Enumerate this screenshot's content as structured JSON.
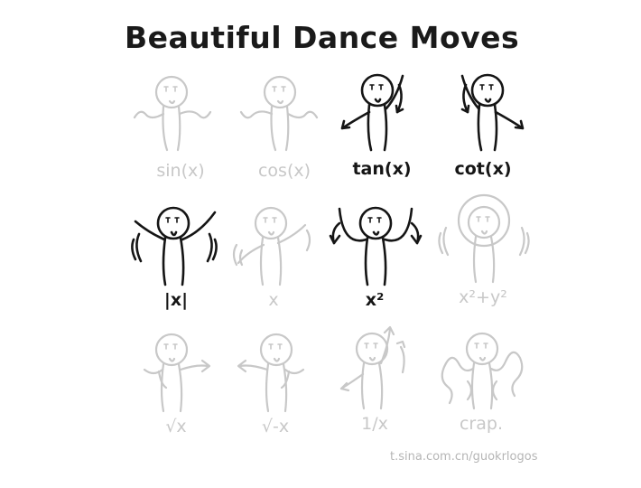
{
  "title": "Beautiful Dance Moves",
  "moves": [
    {
      "label": "sin(x)",
      "highlighted": false
    },
    {
      "label": "cos(x)",
      "highlighted": false
    },
    {
      "label": "tan(x)",
      "highlighted": true
    },
    {
      "label": "cot(x)",
      "highlighted": true
    },
    {
      "label": "|x|",
      "highlighted": true
    },
    {
      "label": "x",
      "highlighted": false
    },
    {
      "label": "x²",
      "highlighted": true
    },
    {
      "label": "x²+y²",
      "highlighted": false
    },
    {
      "label": "√x",
      "highlighted": false
    },
    {
      "label": "√-x",
      "highlighted": false
    },
    {
      "label": "1/x",
      "highlighted": false
    },
    {
      "label": "crap.",
      "highlighted": false
    }
  ],
  "watermark": "t.sina.com.cn/guokrlogos",
  "colors": {
    "ink": "#151515",
    "faded": "#c8c8c8"
  }
}
